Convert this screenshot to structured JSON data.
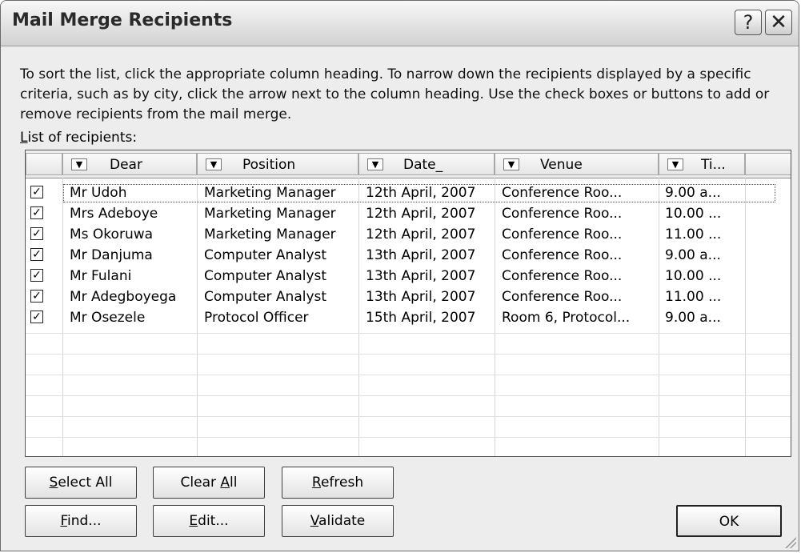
{
  "window": {
    "title": "Mail Merge Recipients",
    "help_glyph": "?",
    "close_glyph": "✕"
  },
  "description": "To sort the list, click the appropriate column heading.  To narrow down the recipients displayed by a specific criteria, such as by city, click the arrow next to the column heading.  Use the check boxes or buttons to add or remove recipients from the mail merge.",
  "list": {
    "label_accel": "L",
    "label_rest": "ist of recipients:",
    "columns": [
      "Dear",
      "Position",
      "Date_",
      "Venue",
      "Ti..."
    ],
    "dropdown_glyph": "▼",
    "check_glyph": "✓",
    "rows": [
      {
        "checked": true,
        "dear": "Mr Udoh",
        "position": "Marketing Manager",
        "date": "12th April, 2007",
        "venue": "Conference Roo...",
        "time": "9.00 a..."
      },
      {
        "checked": true,
        "dear": "Mrs Adeboye",
        "position": "Marketing Manager",
        "date": "12th April, 2007",
        "venue": "Conference Roo...",
        "time": "10.00 ..."
      },
      {
        "checked": true,
        "dear": "Ms Okoruwa",
        "position": "Marketing Manager",
        "date": "12th April, 2007",
        "venue": "Conference Roo...",
        "time": "11.00 ..."
      },
      {
        "checked": true,
        "dear": "Mr Danjuma",
        "position": "Computer Analyst",
        "date": "13th April, 2007",
        "venue": "Conference Roo...",
        "time": "9.00 a..."
      },
      {
        "checked": true,
        "dear": "Mr Fulani",
        "position": "Computer Analyst",
        "date": "13th April, 2007",
        "venue": "Conference Roo...",
        "time": "10.00 ..."
      },
      {
        "checked": true,
        "dear": "Mr Adegboyega",
        "position": "Computer Analyst",
        "date": "13th April, 2007",
        "venue": "Conference Roo...",
        "time": "11.00 ..."
      },
      {
        "checked": true,
        "dear": "Mr Osezele",
        "position": "Protocol Officer",
        "date": "15th April, 2007",
        "venue": "Room 6, Protocol...",
        "time": "9.00 a..."
      }
    ]
  },
  "buttons": {
    "select_all": {
      "accel": "S",
      "rest": "elect All"
    },
    "clear_all": {
      "pre": "Clear ",
      "accel": "A",
      "rest": "ll"
    },
    "refresh": {
      "accel": "R",
      "rest": "efresh"
    },
    "find": {
      "accel": "F",
      "rest": "ind..."
    },
    "edit": {
      "accel": "E",
      "rest": "dit..."
    },
    "validate": {
      "accel": "V",
      "rest": "alidate"
    },
    "ok": "OK"
  }
}
